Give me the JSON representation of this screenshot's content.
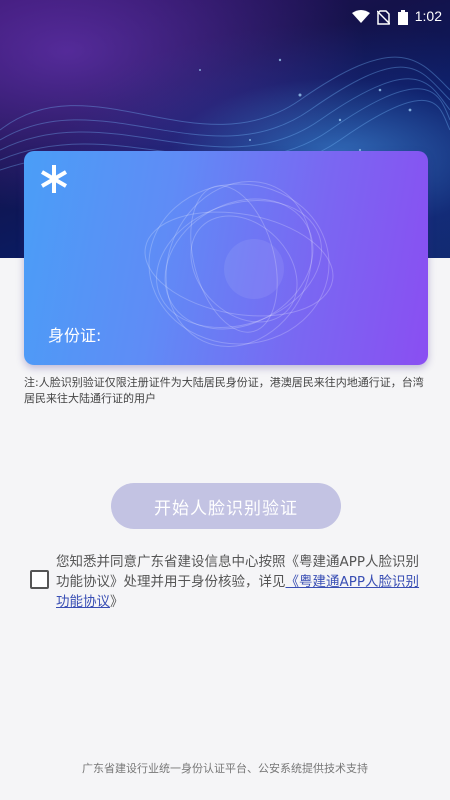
{
  "status_bar": {
    "time": "1:02",
    "icons": [
      "wifi-icon",
      "no-sim-icon",
      "battery-icon"
    ]
  },
  "card": {
    "id_label": "身份证:",
    "icon": "asterisk-icon"
  },
  "note": "注:人脸识别验证仅限注册证件为大陆居民身份证，港澳居民来往内地通行证，台湾居民来往大陆通行证的用户",
  "start_button": {
    "label": "开始人脸识别验证"
  },
  "agreement": {
    "text_before": "您知悉并同意广东省建设信息中心按照《粤建通APP人脸识别功能协议》处理并用于身份核验，详见",
    "link_open": "《",
    "link_text": "粤建通APP人脸识别功能协议",
    "link_close": "》"
  },
  "footer": "广东省建设行业统一身份认证平台、公安系统提供技术支持",
  "colors": {
    "button": "#c3c3e3",
    "link": "#3a4fb4",
    "card_start": "#4a9ef7",
    "card_end": "#8a4ef2"
  }
}
